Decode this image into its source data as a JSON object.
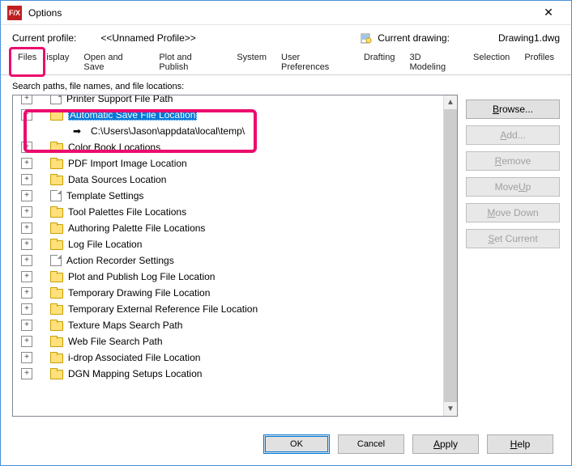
{
  "window": {
    "title": "Options",
    "app_icon_text": "F/X"
  },
  "profile": {
    "current_label": "Current profile:",
    "current_value": "<<Unnamed Profile>>",
    "drawing_label": "Current drawing:",
    "drawing_value": "Drawing1.dwg"
  },
  "tabs": [
    "Files",
    "Display",
    "Open and Save",
    "Plot and Publish",
    "System",
    "User Preferences",
    "Drafting",
    "3D Modeling",
    "Selection",
    "Profiles"
  ],
  "active_tab_index": 0,
  "caption": "Search paths, file names, and file locations:",
  "tree": [
    {
      "level": 0,
      "expander": "plus",
      "icon": "file",
      "label": "Printer Support File Path",
      "partial": true
    },
    {
      "level": 0,
      "expander": "minus",
      "icon": "folder",
      "label": "Automatic Save File Location",
      "selected": true
    },
    {
      "level": 1,
      "expander": "none",
      "icon": "arrow",
      "label": "C:\\Users\\Jason\\appdata\\local\\temp\\"
    },
    {
      "level": 0,
      "expander": "plus",
      "icon": "folder",
      "label": "Color Book Locations"
    },
    {
      "level": 0,
      "expander": "plus",
      "icon": "folder",
      "label": "PDF Import Image Location"
    },
    {
      "level": 0,
      "expander": "plus",
      "icon": "folder",
      "label": "Data Sources Location"
    },
    {
      "level": 0,
      "expander": "plus",
      "icon": "file",
      "label": "Template Settings"
    },
    {
      "level": 0,
      "expander": "plus",
      "icon": "folder",
      "label": "Tool Palettes File Locations"
    },
    {
      "level": 0,
      "expander": "plus",
      "icon": "folder",
      "label": "Authoring Palette File Locations"
    },
    {
      "level": 0,
      "expander": "plus",
      "icon": "folder",
      "label": "Log File Location"
    },
    {
      "level": 0,
      "expander": "plus",
      "icon": "file",
      "label": "Action Recorder Settings"
    },
    {
      "level": 0,
      "expander": "plus",
      "icon": "folder",
      "label": "Plot and Publish Log File Location"
    },
    {
      "level": 0,
      "expander": "plus",
      "icon": "folder",
      "label": "Temporary Drawing File Location"
    },
    {
      "level": 0,
      "expander": "plus",
      "icon": "folder",
      "label": "Temporary External Reference File Location"
    },
    {
      "level": 0,
      "expander": "plus",
      "icon": "folder",
      "label": "Texture Maps Search Path"
    },
    {
      "level": 0,
      "expander": "plus",
      "icon": "folder",
      "label": "Web File Search Path"
    },
    {
      "level": 0,
      "expander": "plus",
      "icon": "folder",
      "label": "i-drop Associated File Location"
    },
    {
      "level": 0,
      "expander": "plus",
      "icon": "folder",
      "label": "DGN Mapping Setups Location"
    }
  ],
  "side_buttons": [
    {
      "label": "Browse...",
      "ul": "B",
      "rest": "rowse...",
      "enabled": true
    },
    {
      "label": "Add...",
      "ul": "A",
      "rest": "dd...",
      "enabled": false
    },
    {
      "label": "Remove",
      "ul": "R",
      "rest": "emove",
      "enabled": false
    },
    {
      "label": "Move Up",
      "ul": "U",
      "pre": "Move ",
      "rest": "p",
      "enabled": false
    },
    {
      "label": "Move Down",
      "ul": "M",
      "rest": "ove Down",
      "enabled": false
    },
    {
      "label": "Set Current",
      "ul": "S",
      "rest": "et Current",
      "enabled": false
    }
  ],
  "bottom_buttons": {
    "ok": "OK",
    "cancel": "Cancel",
    "apply": "Apply",
    "help": "Help"
  },
  "highlight": {
    "tab_index": 0,
    "tree_rows": [
      1,
      2
    ]
  },
  "colors": {
    "highlight": "#ec0b6e",
    "selection": "#0078d7",
    "folder": "#ffe07a"
  }
}
